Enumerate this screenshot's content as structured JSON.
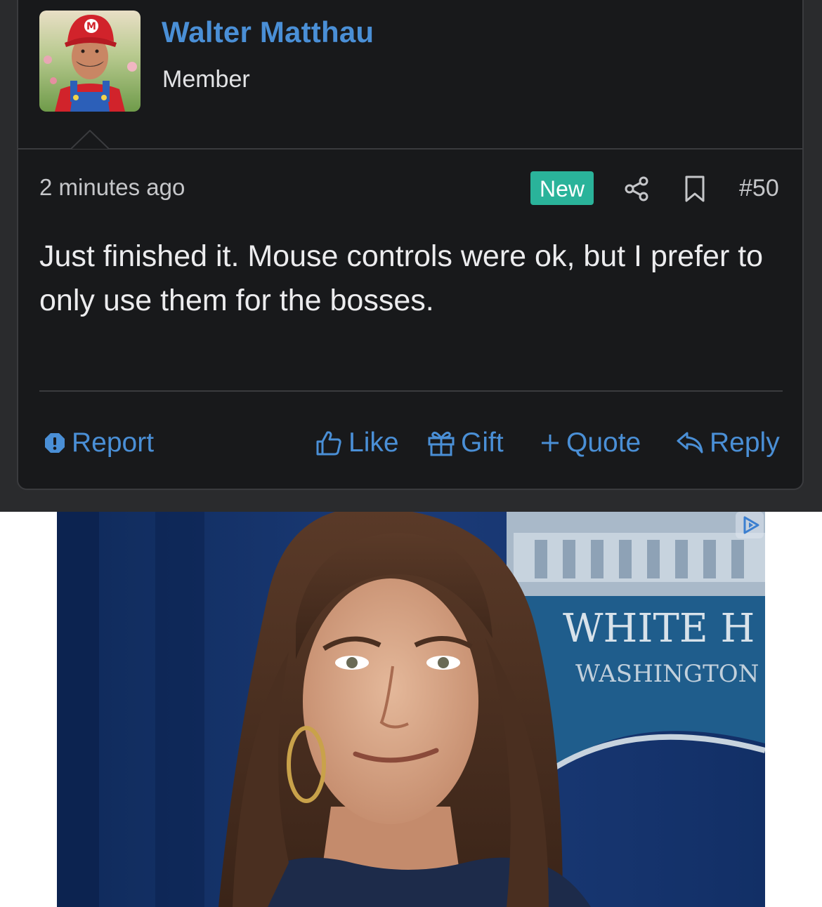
{
  "post": {
    "author": {
      "name": "Walter Matthau",
      "title": "Member",
      "avatar_icon": "avatar-photo-icon"
    },
    "meta": {
      "timestamp": "2 minutes ago",
      "badge": "New",
      "post_number": "#50",
      "share_icon": "share-icon",
      "bookmark_icon": "bookmark-icon"
    },
    "body": "Just finished it. Mouse controls were ok, but I prefer to only use them for the bosses.",
    "actions": {
      "report": "Report",
      "like": "Like",
      "gift": "Gift",
      "quote": "Quote",
      "reply": "Reply"
    }
  },
  "ad": {
    "image_text_line1": "WHITE H",
    "image_text_line2": "WASHINGTON",
    "badge_icon": "ad-choices-icon"
  },
  "colors": {
    "background": "#18191b",
    "link": "#4a8fd6",
    "badge": "#2ab39a",
    "text": "#ececee"
  }
}
